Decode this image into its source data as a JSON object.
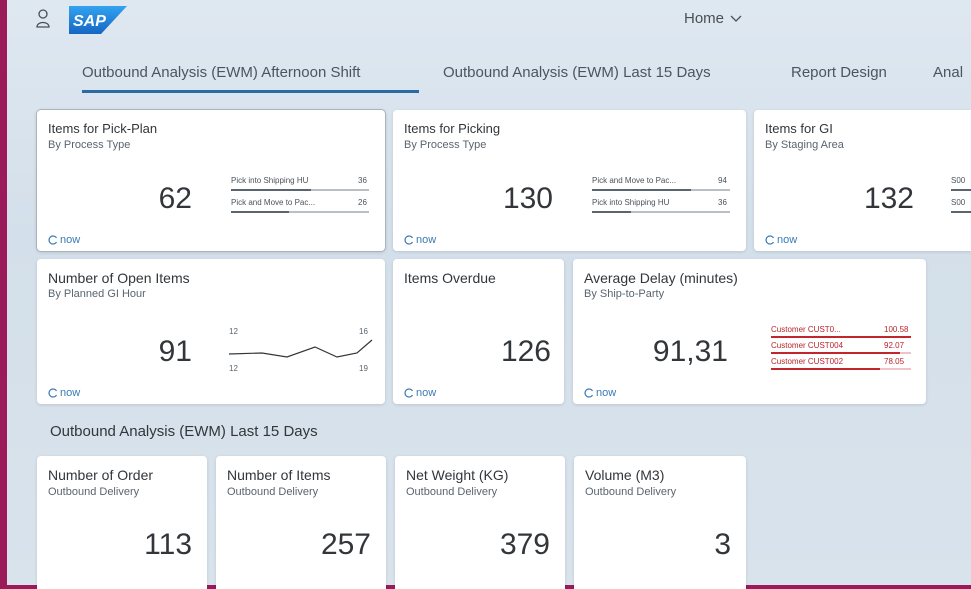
{
  "shell": {
    "home_title": "Home",
    "logo_text": "SAP"
  },
  "tabs": [
    {
      "label": "Outbound Analysis (EWM) Afternoon Shift",
      "selected": true
    },
    {
      "label": "Outbound Analysis (EWM) Last 15 Days",
      "selected": false
    },
    {
      "label": "Report Design",
      "selected": false
    },
    {
      "label": "Anal",
      "selected": false
    }
  ],
  "refresh_label": "now",
  "row1": [
    {
      "title": "Items for Pick-Plan",
      "subtitle": "By Process Type",
      "value": "62",
      "bars": [
        {
          "label": "Pick into Shipping HU",
          "value": "36",
          "fraction": 0.58
        },
        {
          "label": "Pick and Move to Pac...",
          "value": "26",
          "fraction": 0.42
        }
      ]
    },
    {
      "title": "Items for Picking",
      "subtitle": "By Process Type",
      "value": "130",
      "bars": [
        {
          "label": "Pick and Move to Pac...",
          "value": "94",
          "fraction": 0.72
        },
        {
          "label": "Pick into Shipping HU",
          "value": "36",
          "fraction": 0.28
        }
      ]
    },
    {
      "title": "Items for GI",
      "subtitle": "By Staging Area",
      "value": "132",
      "bars": [
        {
          "label": "S00",
          "value": ""
        },
        {
          "label": "S00",
          "value": ""
        }
      ]
    }
  ],
  "row2": {
    "open_items": {
      "title": "Number of Open Items",
      "subtitle": "By Planned GI Hour",
      "value": "91",
      "spark": {
        "left_top": "12",
        "right_top": "16",
        "left_bottom": "12",
        "right_bottom": "19"
      }
    },
    "overdue": {
      "title": "Items Overdue",
      "value": "126"
    },
    "delay": {
      "title": "Average Delay (minutes)",
      "subtitle": "By Ship-to-Party",
      "value": "91,31",
      "bars": [
        {
          "label": "Customer CUST0...",
          "value": "100.58",
          "fraction": 1.0
        },
        {
          "label": "Customer CUST004",
          "value": "92.07",
          "fraction": 0.92
        },
        {
          "label": "Customer CUST002",
          "value": "78.05",
          "fraction": 0.78
        }
      ]
    }
  },
  "section": {
    "title": "Outbound Analysis (EWM) Last 15 Days"
  },
  "row3": [
    {
      "title": "Number of Order",
      "subtitle": "Outbound Delivery",
      "value": "113"
    },
    {
      "title": "Number of Items",
      "subtitle": "Outbound Delivery",
      "value": "257"
    },
    {
      "title": "Net Weight (KG)",
      "subtitle": "Outbound Delivery",
      "value": "379"
    },
    {
      "title": "Volume (M3)",
      "subtitle": "Outbound Delivery",
      "value": "3"
    }
  ],
  "colors": {
    "accent": "#2b6aa3",
    "refresh": "#3b7ab5",
    "alert": "#c2262d",
    "sap_blue": "#1d7ad6",
    "frame": "#9a1a5a"
  },
  "icons": {
    "user": "person-icon",
    "refresh": "refresh-icon",
    "menu": "chevron-down-icon"
  }
}
